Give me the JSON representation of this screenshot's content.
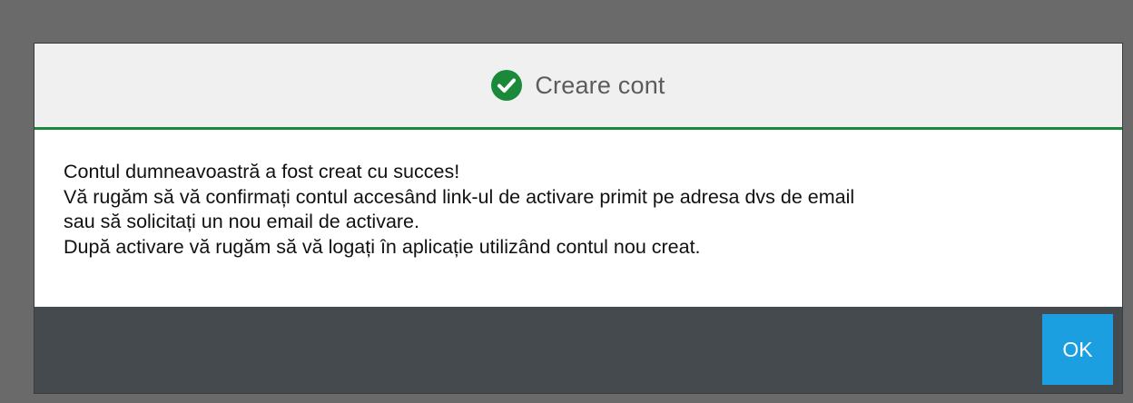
{
  "dialog": {
    "title": "Creare cont",
    "icon": "check-circle-icon",
    "accent_color": "#1a8a3a",
    "lines": [
      "Contul dumneavoastră a fost creat cu succes!",
      "Vă rugăm să vă confirmați contul accesând link-ul de activare primit pe adresa dvs de email",
      "sau să solicitați un nou email de activare.",
      "După activare vă rugăm să vă logați în aplicație utilizând contul nou creat."
    ],
    "ok_label": "OK",
    "ok_color": "#1b9fe0"
  }
}
